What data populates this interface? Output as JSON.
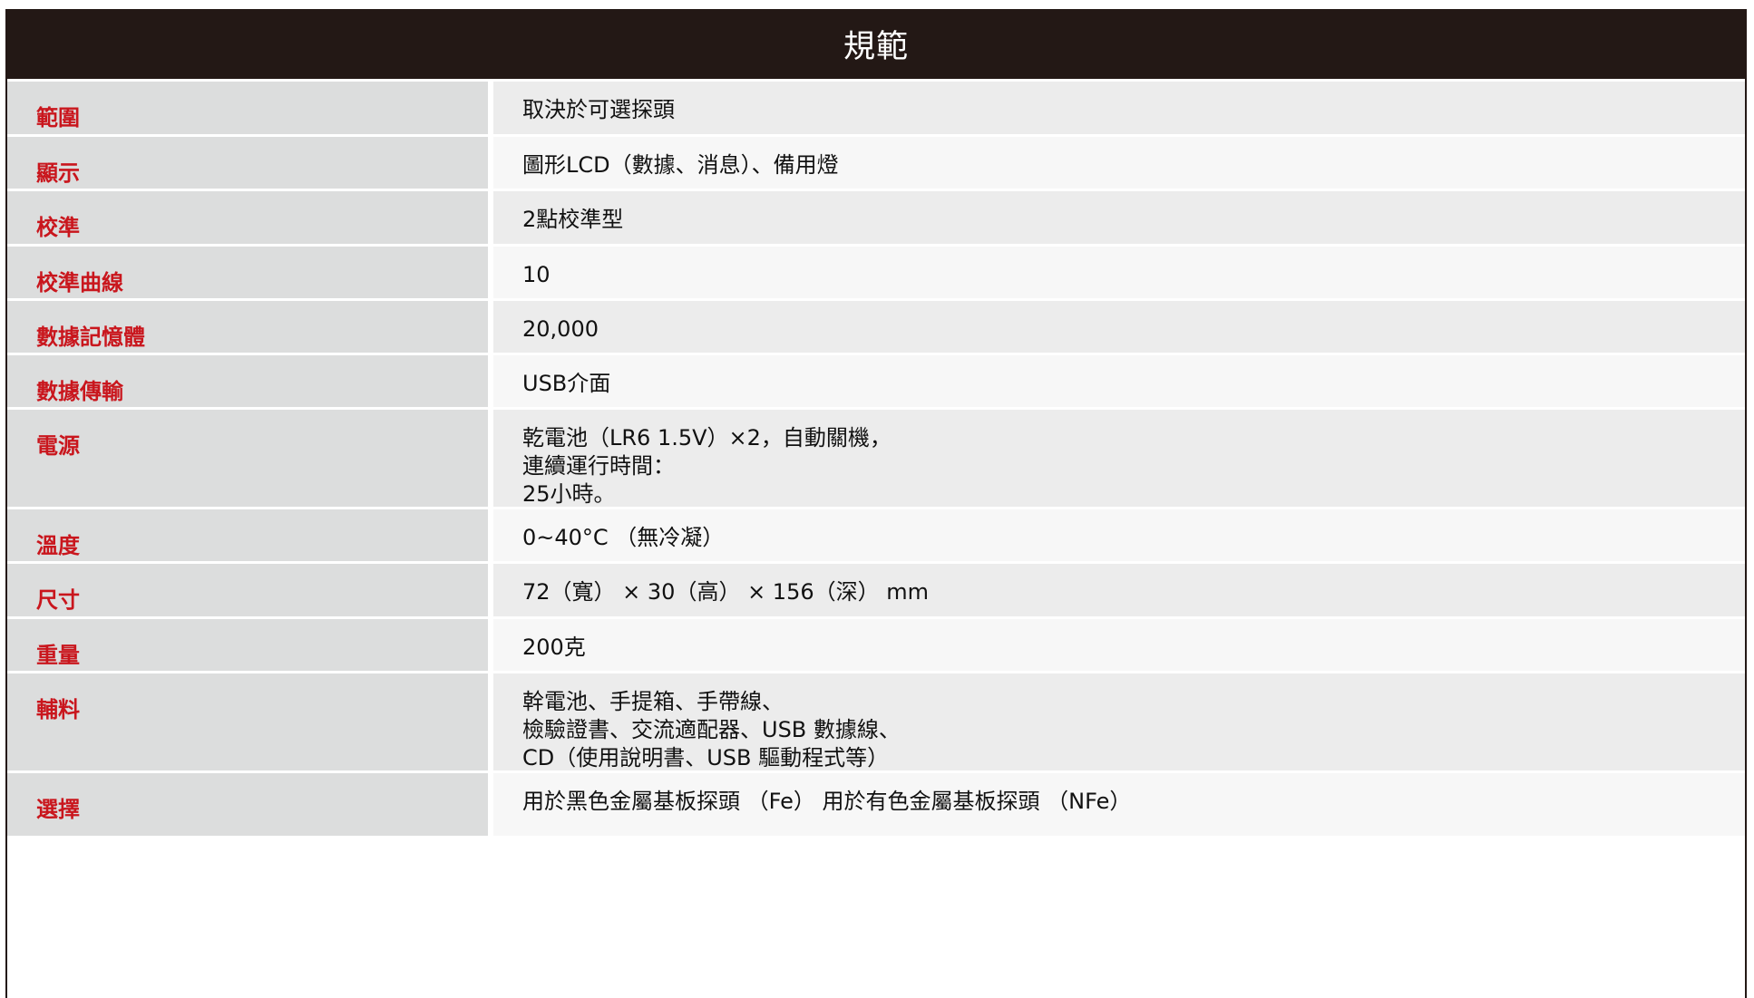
{
  "header": {
    "title": "規範"
  },
  "rows": [
    {
      "label": "範圍",
      "lines": [
        "取決於可選探頭"
      ]
    },
    {
      "label": "顯示",
      "lines": [
        "圖形LCD（數據、消息）、備用燈"
      ]
    },
    {
      "label": "校準",
      "lines": [
        "2點校準型"
      ]
    },
    {
      "label": "校準曲線",
      "lines": [
        "10"
      ]
    },
    {
      "label": "數據記憶體",
      "lines": [
        "20,000"
      ]
    },
    {
      "label": "數據傳輸",
      "lines": [
        "USB介面"
      ]
    },
    {
      "label": "電源",
      "lines": [
        "乾電池（LR6 1.5V）×2，自動關機，",
        "連續運行時間：",
        "25小時。"
      ]
    },
    {
      "label": "溫度",
      "lines": [
        "0~40°C （無冷凝）"
      ]
    },
    {
      "label": "尺寸",
      "lines": [
        "72（寬） × 30（高） × 156（深） mm"
      ]
    },
    {
      "label": "重量",
      "lines": [
        "200克"
      ]
    },
    {
      "label": "輔料",
      "lines": [
        "幹電池、手提箱、手帶線、",
        "檢驗證書、交流適配器、USB 數據線、",
        "CD（使用說明書、USB 驅動程式等）"
      ]
    },
    {
      "label": "選擇",
      "lines": [
        "用於黑色金屬基板探頭 （Fe） 用於有色金屬基板探頭 （NFe）"
      ]
    }
  ]
}
